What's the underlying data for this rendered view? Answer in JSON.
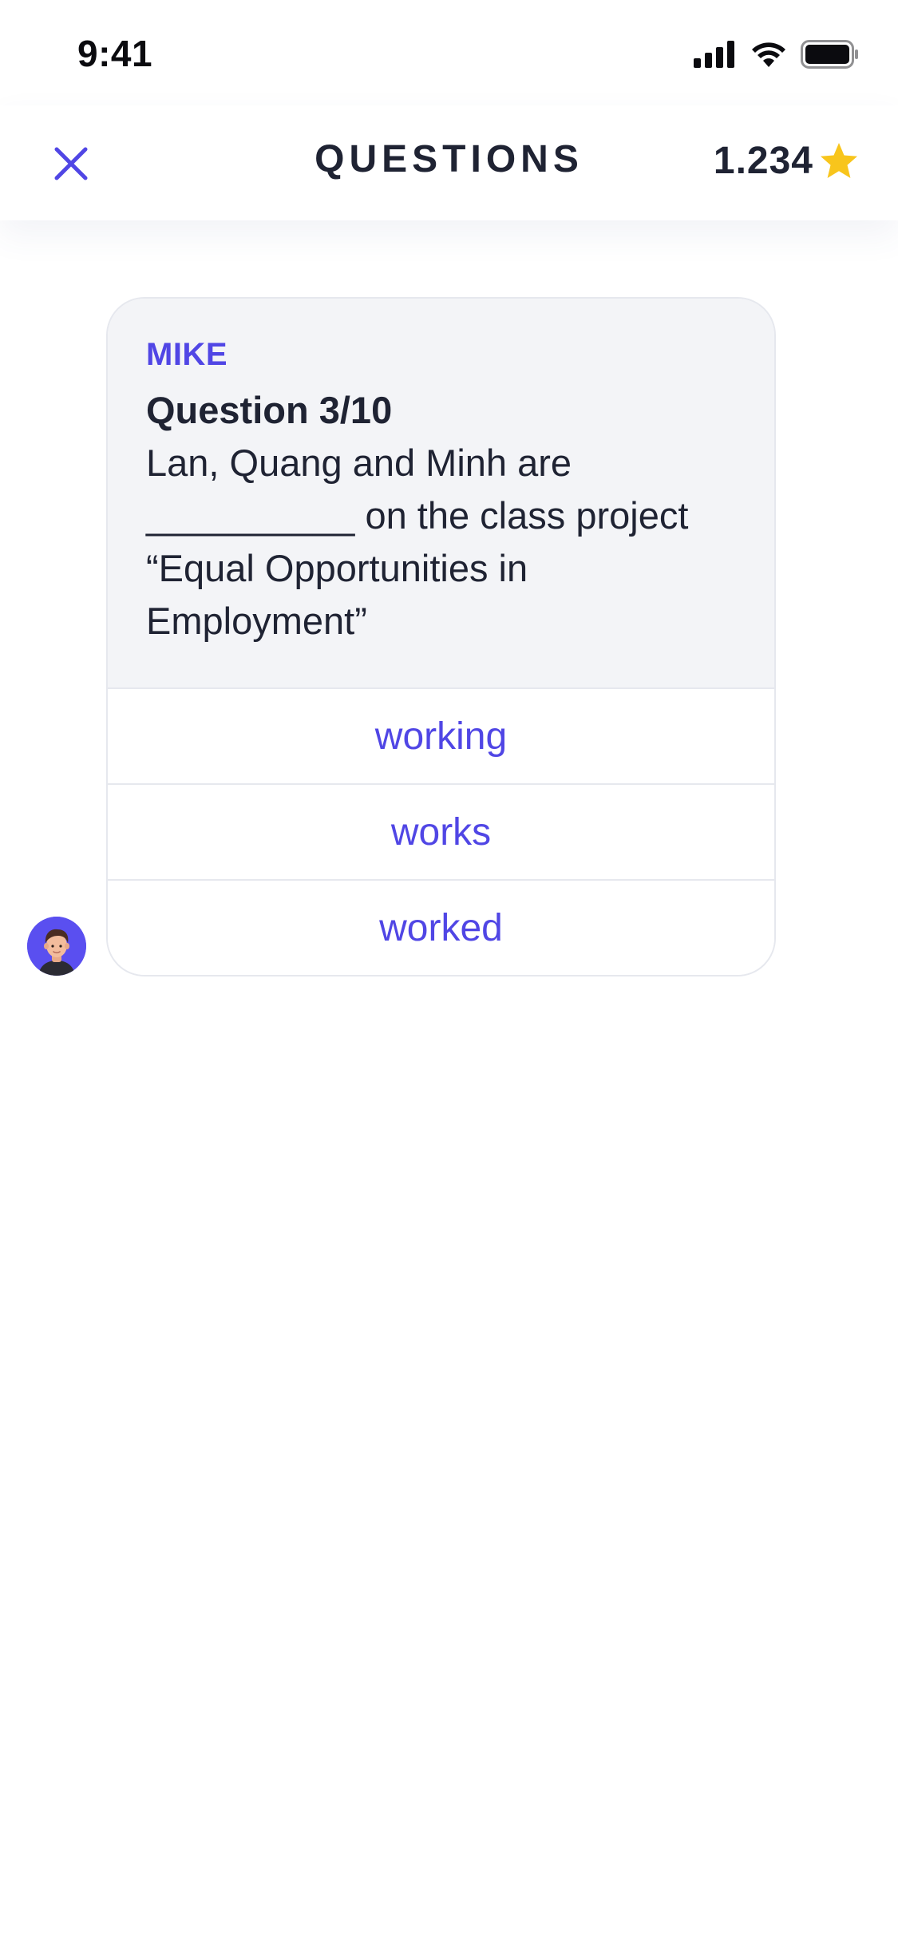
{
  "status_bar": {
    "time": "9:41"
  },
  "header": {
    "title": "QUESTIONS",
    "score": "1.234",
    "close_icon": "close-icon",
    "star_icon": "star-icon"
  },
  "message": {
    "sender": "MIKE",
    "question_number": "Question 3/10",
    "question_text": "Lan, Quang and Minh are __________ on the class project “Equal Opportunities in Employment”",
    "options": [
      {
        "label": "working"
      },
      {
        "label": "works"
      },
      {
        "label": "worked"
      }
    ]
  },
  "colors": {
    "accent": "#5046E5",
    "star": "#F8C51C",
    "card_background": "#F3F4F7",
    "text_primary": "#1F2333"
  }
}
